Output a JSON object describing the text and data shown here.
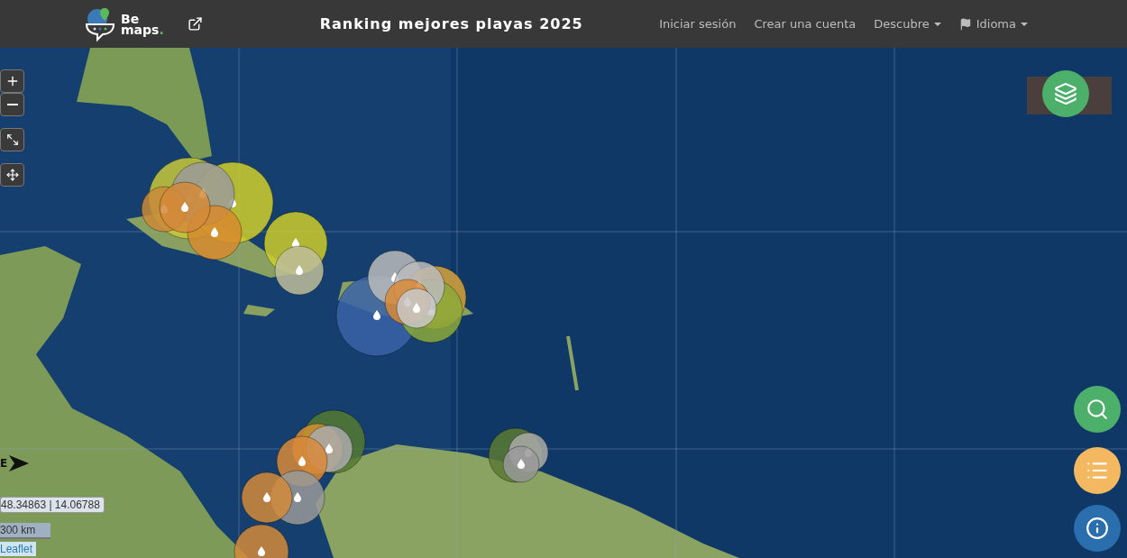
{
  "header": {
    "logo": {
      "line1": "Be",
      "line2": "maps",
      "dot": "."
    },
    "title": "Ranking mejores playas 2025",
    "nav": [
      {
        "label": "Iniciar sesión",
        "kind": "link"
      },
      {
        "label": "Crear una cuenta",
        "kind": "link"
      },
      {
        "label": "Descubre",
        "kind": "dropdown"
      },
      {
        "label": "Idioma",
        "kind": "language"
      }
    ]
  },
  "map": {
    "compass_letter": "E",
    "coordinates": "48.34863 | 14.06788",
    "scale": "300 km",
    "attribution": "Leaflet"
  }
}
